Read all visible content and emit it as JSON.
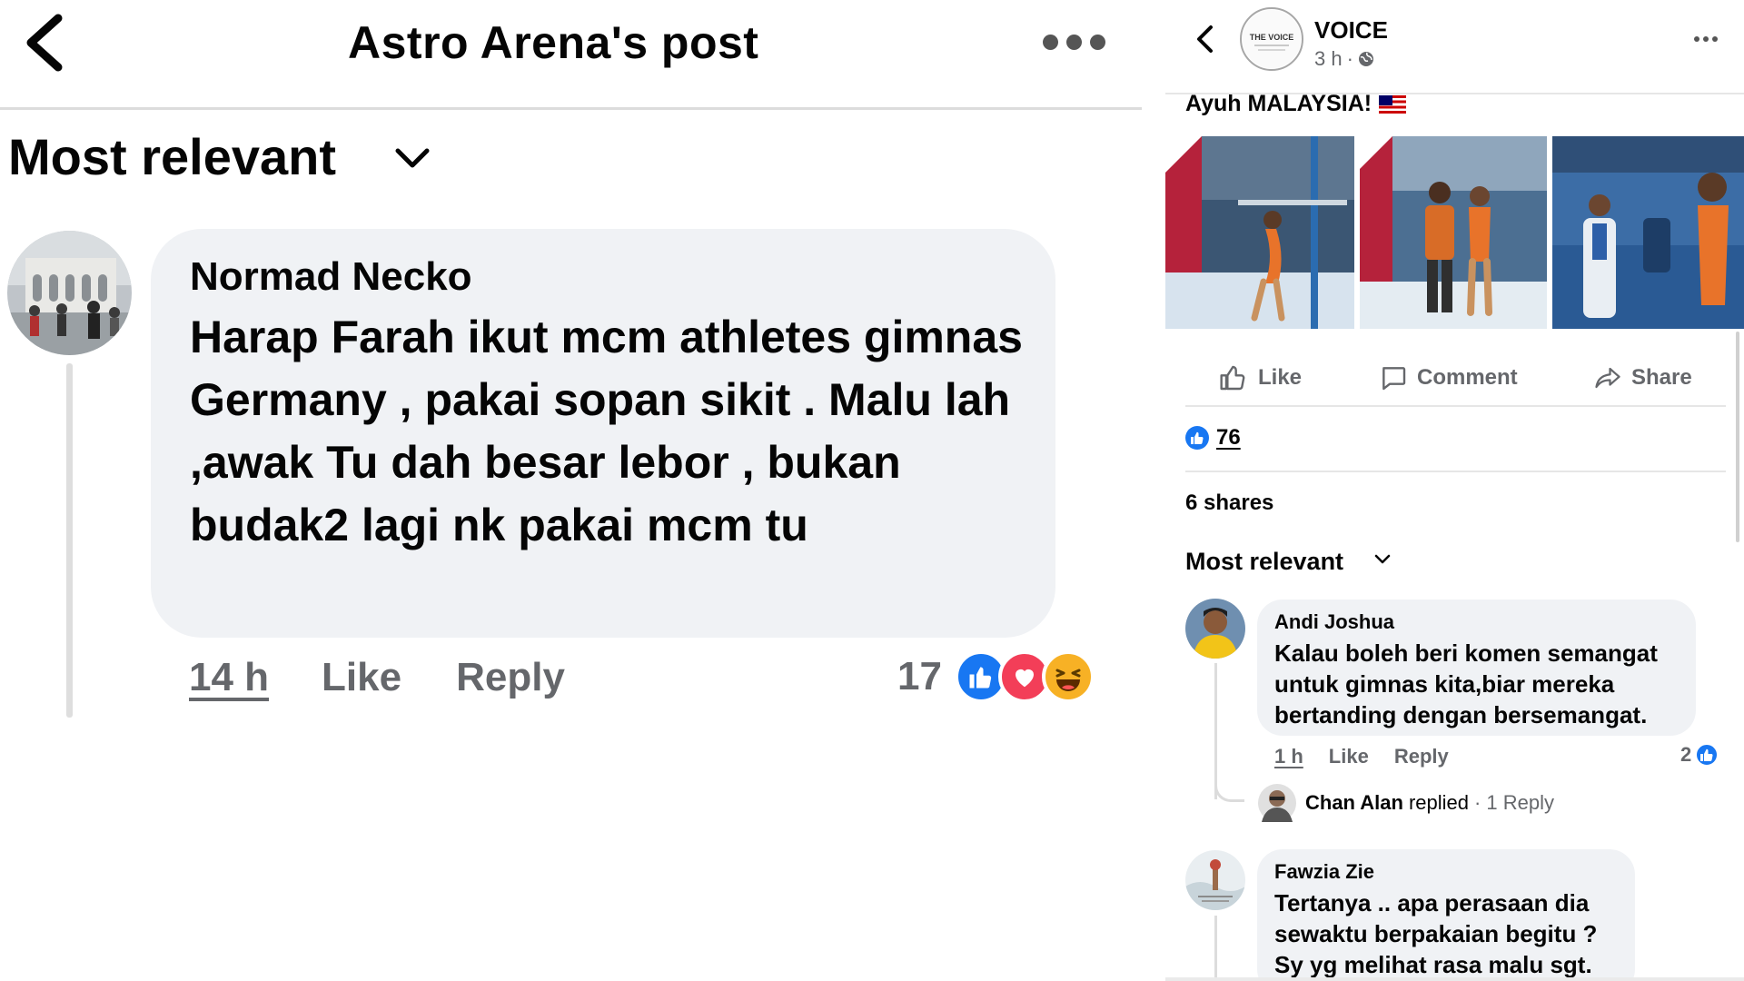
{
  "left": {
    "header": {
      "title": "Astro Arena's post"
    },
    "sort": {
      "label": "Most relevant"
    },
    "comment": {
      "author": "Normad Necko",
      "text": "Harap Farah ikut mcm athletes gimnas Germany , pakai sopan sikit . Malu lah ,awak Tu dah besar lebor , bukan budak2 lagi nk pakai mcm tu",
      "time": "14 h",
      "like_label": "Like",
      "reply_label": "Reply",
      "reaction_count": "17",
      "reactions": [
        "like-reaction-icon",
        "love-reaction-icon",
        "haha-reaction-icon"
      ]
    }
  },
  "right": {
    "header": {
      "page_name": "VOICE",
      "time": "3 h",
      "logo_text": "THE VOICE"
    },
    "post": {
      "caption": "Ayuh MALAYSIA!"
    },
    "actions": {
      "like": "Like",
      "comment": "Comment",
      "share": "Share"
    },
    "stats": {
      "likes": "76",
      "shares": "6 shares"
    },
    "sort": {
      "label": "Most relevant"
    },
    "comments": [
      {
        "author": "Andi Joshua",
        "lines": [
          "Kalau boleh beri komen semangat",
          "untuk gimnas kita,biar mereka",
          "bertanding dengan bersemangat."
        ],
        "time": "1 h",
        "like_label": "Like",
        "reply_label": "Reply",
        "reaction_count": "2",
        "reply": {
          "author": "Chan Alan",
          "verb": "replied",
          "count": "1 Reply"
        }
      },
      {
        "author": "Fawzia Zie",
        "lines": [
          "Tertanya .. apa perasaan dia",
          "sewaktu berpakaian begitu ?",
          "Sy yg melihat rasa malu sgt."
        ]
      }
    ]
  },
  "colors": {
    "fb_blue": "#1877f2",
    "love_red": "#f33e58",
    "haha_yellow": "#f7b125",
    "gymnast_orange": "#e8732a",
    "olympic_red": "#b5223b"
  }
}
